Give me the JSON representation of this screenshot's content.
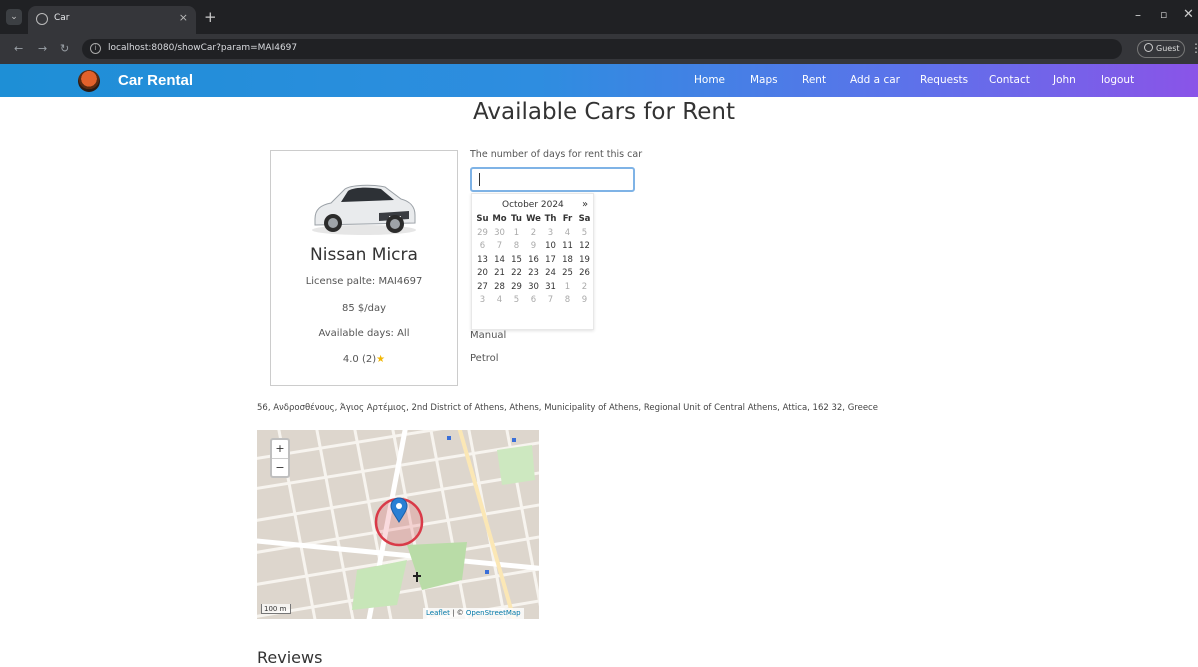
{
  "browser": {
    "tab_title": "Car",
    "tab_close": "×",
    "new_tab": "+",
    "url": "localhost:8080/showCar?param=MAI4697",
    "profile_label": "Guest",
    "window_controls": {
      "minimize": "–",
      "maximize": "▫",
      "close": "✕"
    },
    "nav": {
      "back": "←",
      "forward": "→",
      "reload": "↻"
    },
    "menu": "⋮"
  },
  "navbar": {
    "brand": "Car Rental",
    "links": [
      "Home",
      "Maps",
      "Rent",
      "Add a car",
      "Requests",
      "Contact",
      "John",
      "logout"
    ],
    "colors": {
      "gradient_start": "#1e8fd6",
      "gradient_end": "#8a54e8"
    }
  },
  "page": {
    "title": "Available Cars for Rent"
  },
  "car": {
    "name": "Nissan Micra",
    "license": "License palte: MAI4697",
    "price": "85 $/day",
    "availability": "Available days: All",
    "rating": "4.0 (2)",
    "rating_icon": "star-icon",
    "transmission": "Manual",
    "fuel": "Petrol"
  },
  "rent_form": {
    "days_label": "The number of days for rent this car",
    "days_value": ""
  },
  "datepicker": {
    "month": "October 2024",
    "next": "»",
    "weekdays": [
      "Su",
      "Mo",
      "Tu",
      "We",
      "Th",
      "Fr",
      "Sa"
    ],
    "weeks": [
      [
        "29",
        "30",
        "1",
        "2",
        "3",
        "4",
        "5"
      ],
      [
        "6",
        "7",
        "8",
        "9",
        "10",
        "11",
        "12"
      ],
      [
        "13",
        "14",
        "15",
        "16",
        "17",
        "18",
        "19"
      ],
      [
        "20",
        "21",
        "22",
        "23",
        "24",
        "25",
        "26"
      ],
      [
        "27",
        "28",
        "29",
        "30",
        "31",
        "1",
        "2"
      ],
      [
        "3",
        "4",
        "5",
        "6",
        "7",
        "8",
        "9"
      ]
    ]
  },
  "location": {
    "address": "56, Ανδροσθένους, Άγιος Αρτέμιος, 2nd District of Athens, Athens, Municipality of Athens, Regional Unit of Central Athens, Attica, 162 32, Greece"
  },
  "map": {
    "zoom_in": "+",
    "zoom_out": "−",
    "scale": "100 m",
    "attribution_leaflet": "Leaflet",
    "attribution_sep": " | © ",
    "attribution_osm": "OpenStreetMap"
  },
  "reviews": {
    "heading": "Reviews"
  }
}
